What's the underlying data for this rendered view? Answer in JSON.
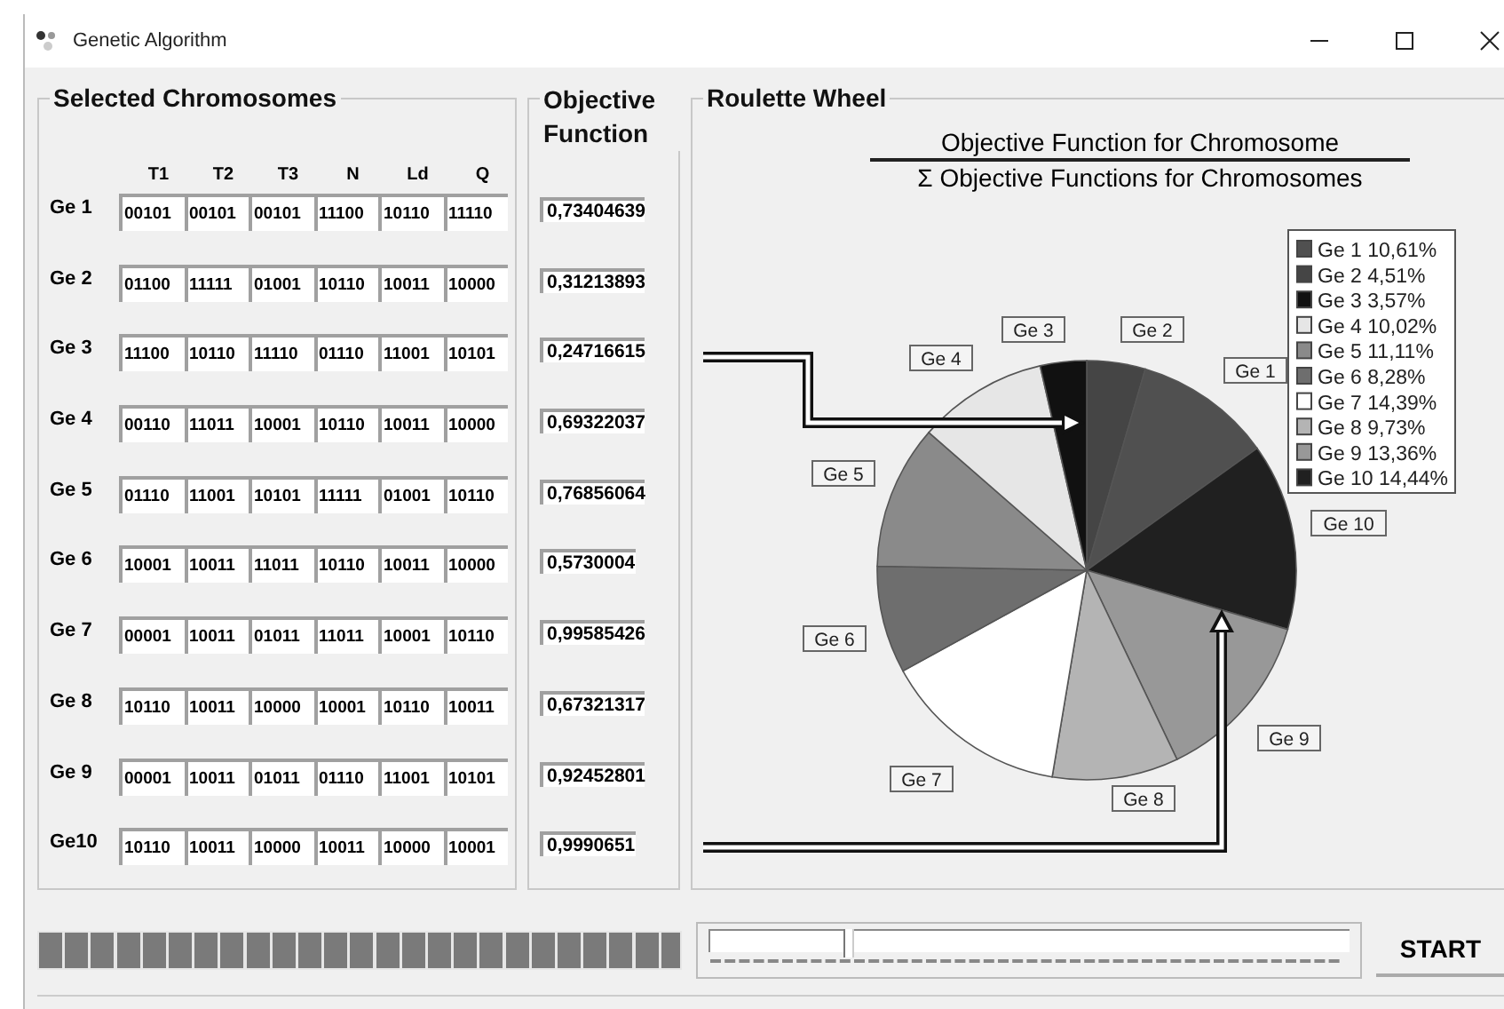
{
  "window": {
    "title": "Genetic Algorithm"
  },
  "chromosomes": {
    "title": "Selected Chromosomes",
    "columns": [
      "T1",
      "T2",
      "T3",
      "N",
      "Ld",
      "Q"
    ],
    "rows": [
      {
        "label": "Ge 1",
        "genes": [
          "00101",
          "00101",
          "00101",
          "11100",
          "10110",
          "11110"
        ]
      },
      {
        "label": "Ge 2",
        "genes": [
          "01100",
          "11111",
          "01001",
          "10110",
          "10011",
          "10000"
        ]
      },
      {
        "label": "Ge 3",
        "genes": [
          "11100",
          "10110",
          "11110",
          "01110",
          "11001",
          "10101"
        ]
      },
      {
        "label": "Ge 4",
        "genes": [
          "00110",
          "11011",
          "10001",
          "10110",
          "10011",
          "10000"
        ]
      },
      {
        "label": "Ge 5",
        "genes": [
          "01110",
          "11001",
          "10101",
          "11111",
          "01001",
          "10110"
        ]
      },
      {
        "label": "Ge 6",
        "genes": [
          "10001",
          "10011",
          "11011",
          "10110",
          "10011",
          "10000"
        ]
      },
      {
        "label": "Ge 7",
        "genes": [
          "00001",
          "10011",
          "01011",
          "11011",
          "10001",
          "10110"
        ]
      },
      {
        "label": "Ge 8",
        "genes": [
          "10110",
          "10011",
          "10000",
          "10001",
          "10110",
          "10011"
        ]
      },
      {
        "label": "Ge 9",
        "genes": [
          "00001",
          "10011",
          "01011",
          "01110",
          "11001",
          "10101"
        ]
      },
      {
        "label": "Ge10",
        "genes": [
          "10110",
          "10011",
          "10000",
          "10011",
          "10000",
          "10001"
        ]
      }
    ]
  },
  "objective": {
    "title": "Objective Function",
    "values": [
      "0,73404639",
      "0,31213893",
      "0,24716615",
      "0,69322037",
      "0,76856064",
      "0,5730004",
      "0,99585426",
      "0,67321317",
      "0,92452801",
      "0,9990651"
    ]
  },
  "roulette": {
    "title": "Roulette Wheel",
    "numerator": "Objective Function for Chromosome",
    "denominator": "Σ Objective Functions for Chromosomes",
    "legend": [
      {
        "text": "Ge 1 10,61%",
        "color": "#505050"
      },
      {
        "text": "Ge 2 4,51%",
        "color": "#454545"
      },
      {
        "text": "Ge 3 3,57%",
        "color": "#111111"
      },
      {
        "text": "Ge 4 10,02%",
        "color": "#e6e6e6"
      },
      {
        "text": "Ge 5 11,11%",
        "color": "#8a8a8a"
      },
      {
        "text": "Ge 6 8,28%",
        "color": "#6e6e6e"
      },
      {
        "text": "Ge 7 14,39%",
        "color": "#ffffff"
      },
      {
        "text": "Ge 8 9,73%",
        "color": "#b4b4b4"
      },
      {
        "text": "Ge 9 13,36%",
        "color": "#989898"
      },
      {
        "text": "Ge 10 14,44%",
        "color": "#202020"
      }
    ],
    "chart_data": {
      "type": "pie",
      "categories": [
        "Ge 1",
        "Ge 2",
        "Ge 3",
        "Ge 4",
        "Ge 5",
        "Ge 6",
        "Ge 7",
        "Ge 8",
        "Ge 9",
        "Ge 10"
      ],
      "values": [
        10.61,
        4.51,
        3.57,
        10.02,
        11.11,
        8.28,
        14.39,
        9.73,
        13.36,
        14.44
      ]
    }
  },
  "progress": {
    "level": 1
  },
  "slider": {
    "level": 0.21
  },
  "start_button": "START"
}
